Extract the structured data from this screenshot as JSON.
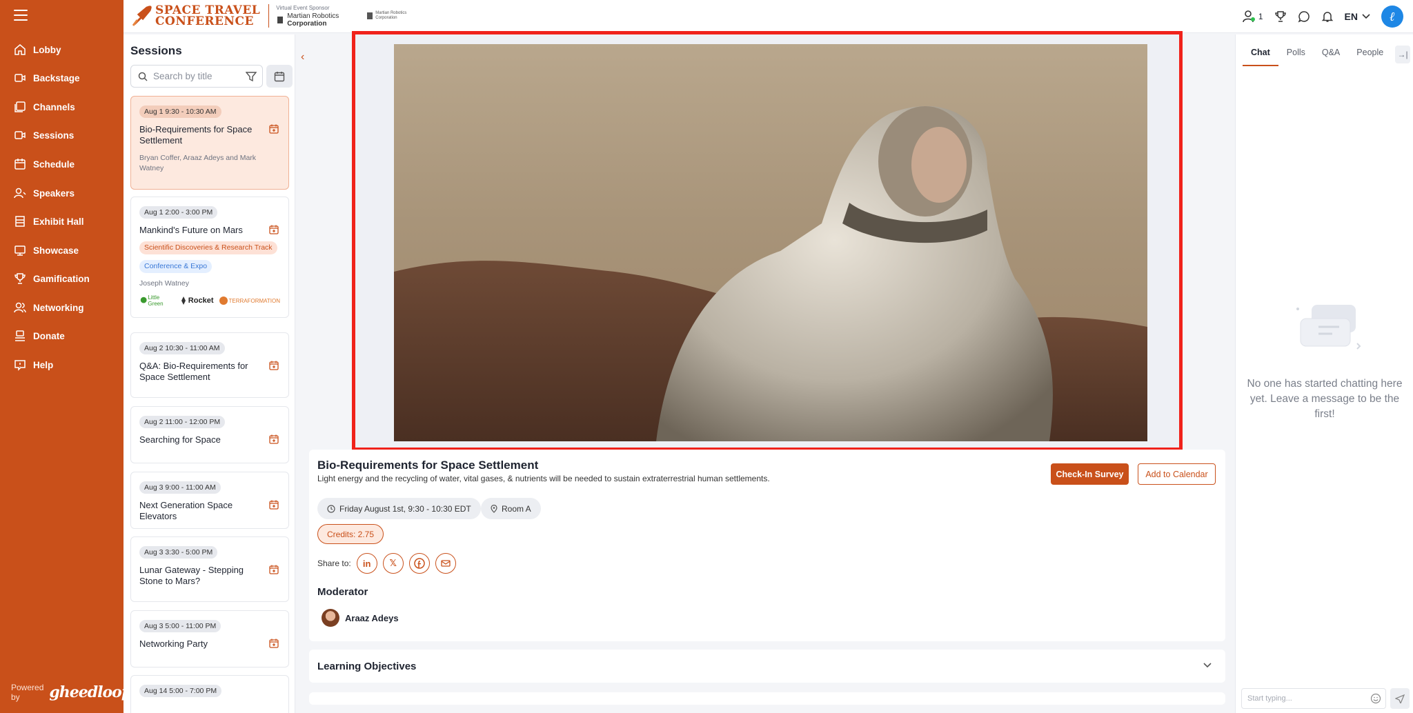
{
  "brand": {
    "title_line1": "SPACE TRAVEL",
    "title_line2": "CONFERENCE",
    "sponsor_label": "Virtual Event Sponsor",
    "sponsor_name_1": "Martian Robotics",
    "sponsor_name_2": "Corporation",
    "sponsor2_name_1": "Martian Robotics",
    "sponsor2_name_2": "Corporation"
  },
  "topbar": {
    "online_count": "1",
    "language": "EN"
  },
  "nav": {
    "items": [
      {
        "label": "Lobby",
        "icon": "home-icon"
      },
      {
        "label": "Backstage",
        "icon": "video-icon"
      },
      {
        "label": "Channels",
        "icon": "channels-icon"
      },
      {
        "label": "Sessions",
        "icon": "video-icon"
      },
      {
        "label": "Schedule",
        "icon": "calendar-icon"
      },
      {
        "label": "Speakers",
        "icon": "speaker-icon"
      },
      {
        "label": "Exhibit Hall",
        "icon": "building-icon"
      },
      {
        "label": "Showcase",
        "icon": "monitor-icon"
      },
      {
        "label": "Gamification",
        "icon": "trophy-icon"
      },
      {
        "label": "Networking",
        "icon": "people-icon"
      },
      {
        "label": "Donate",
        "icon": "donate-icon"
      },
      {
        "label": "Help",
        "icon": "help-icon"
      }
    ],
    "powered_by": "Powered by",
    "powered_logo": "gheedloop"
  },
  "sessions": {
    "heading": "Sessions",
    "search_placeholder": "Search by title",
    "cards": [
      {
        "time": "Aug 1 9:30 - 10:30 AM",
        "title": "Bio-Requirements for Space Settlement",
        "speakers": "Bryan Coffer, Araaz Adeys and Mark Watney"
      },
      {
        "time": "Aug 1 2:00 - 3:00 PM",
        "title": "Mankind's Future on Mars",
        "tag1": "Scientific Discoveries & Research Track",
        "tag2": "Conference & Expo",
        "speakers": "Joseph Watney",
        "sponsor_a": "Little Green",
        "sponsor_b": "Rocket",
        "sponsor_c": "TERRAFORMATION"
      },
      {
        "time": "Aug 2 10:30 - 11:00 AM",
        "title": "Q&A: Bio-Requirements for Space Settlement"
      },
      {
        "time": "Aug 2 11:00 - 12:00 PM",
        "title": "Searching for Space"
      },
      {
        "time": "Aug 3 9:00 - 11:00 AM",
        "title": "Next Generation Space Elevators"
      },
      {
        "time": "Aug 3 3:30 - 5:00 PM",
        "title": "Lunar Gateway - Stepping Stone to Mars?"
      },
      {
        "time": "Aug 3 5:00 - 11:00 PM",
        "title": "Networking Party"
      },
      {
        "time": "Aug 14 5:00 - 7:00 PM"
      }
    ]
  },
  "session": {
    "title": "Bio-Requirements for Space Settlement",
    "description": "Light energy and the recycling of water, vital gases, & nutrients will be needed to sustain extraterrestrial human settlements.",
    "checkin_label": "Check-In Survey",
    "calendar_label": "Add to Calendar",
    "datetime": "Friday August 1st, 9:30 - 10:30 EDT",
    "room": "Room A",
    "credits": "Credits: 2.75",
    "share_label": "Share to:",
    "moderator_heading": "Moderator",
    "moderator_name": "Araaz Adeys",
    "learning_heading": "Learning Objectives"
  },
  "chat": {
    "tabs": [
      "Chat",
      "Polls",
      "Q&A",
      "People"
    ],
    "empty_message": "No one has started chatting here yet. Leave a message to be the first!",
    "input_placeholder": "Start typing..."
  },
  "colors": {
    "brand": "#c9501a",
    "highlight": "#f0221b",
    "avatar": "#1e87e5"
  }
}
